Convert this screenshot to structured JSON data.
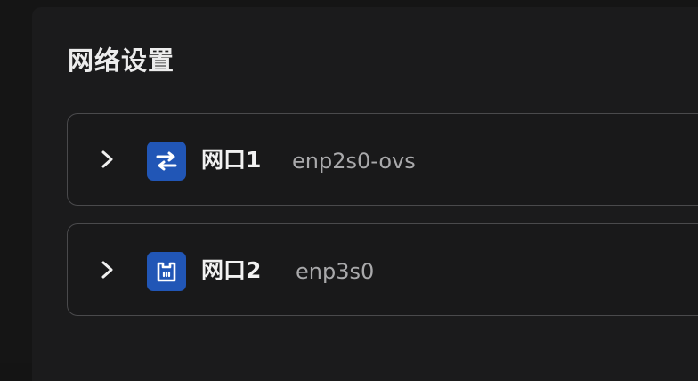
{
  "network_settings": {
    "title": "网络设置",
    "interfaces": [
      {
        "label": "网口1",
        "device": "enp2s0-ovs",
        "icon": "bidirectional-arrows-icon",
        "icon_color": "#2156b6",
        "expanded": false
      },
      {
        "label": "网口2",
        "device": "enp3s0",
        "icon": "ethernet-port-icon",
        "icon_color": "#2156b6",
        "expanded": false
      }
    ]
  }
}
